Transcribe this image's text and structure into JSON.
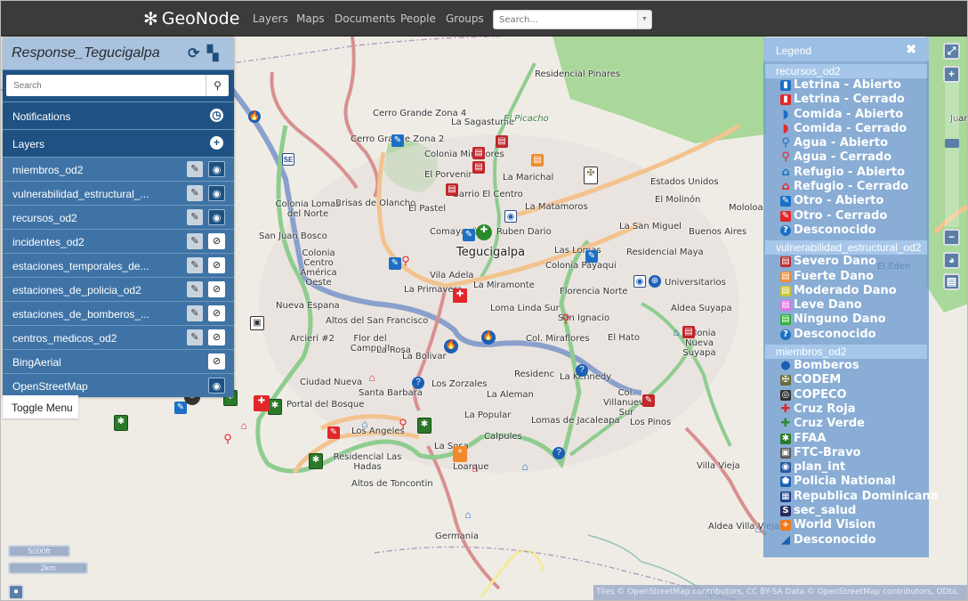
{
  "navbar": {
    "brand": "GeoNode",
    "links": [
      "Layers",
      "Maps",
      "Documents",
      "People",
      "Groups"
    ],
    "search_placeholder": "Search..."
  },
  "panel": {
    "title": "Response_Tegucigalpa",
    "refresh_icon": "refresh-icon",
    "save_icon": "save-icon",
    "search_placeholder": "Search",
    "sections": {
      "notifications": "Notifications",
      "layers": "Layers"
    },
    "layers": [
      {
        "name": "miembros_od2",
        "editable": true,
        "visible": true
      },
      {
        "name": "vulnerabilidad_estructural_...",
        "editable": true,
        "visible": true
      },
      {
        "name": "recursos_od2",
        "editable": true,
        "visible": true
      },
      {
        "name": "incidentes_od2",
        "editable": true,
        "visible": false
      },
      {
        "name": "estaciones_temporales_de...",
        "editable": true,
        "visible": false
      },
      {
        "name": "estaciones_de_policia_od2",
        "editable": true,
        "visible": false
      },
      {
        "name": "estaciones_de_bomberos_...",
        "editable": true,
        "visible": false
      },
      {
        "name": "centros_medicos_od2",
        "editable": true,
        "visible": false
      },
      {
        "name": "BingAerial",
        "editable": false,
        "visible": false
      },
      {
        "name": "OpenStreetMap",
        "editable": false,
        "visible": true
      }
    ],
    "toggle_menu": "Toggle Menu"
  },
  "legend": {
    "title": "Legend",
    "groups": [
      {
        "name": "recursos_od2",
        "items": [
          {
            "label": "Letrina - Abierto",
            "icon": "latrine-icon",
            "color": "#1b6fc4"
          },
          {
            "label": "Letrina - Cerrado",
            "icon": "latrine-icon",
            "color": "#e3262a"
          },
          {
            "label": "Comida - Abierto",
            "icon": "food-icon",
            "color": "#1b6fc4"
          },
          {
            "label": "Comida - Cerrado",
            "icon": "food-icon",
            "color": "#e3262a"
          },
          {
            "label": "Agua - Abierto",
            "icon": "water-tap-icon",
            "color": "#1b6fc4"
          },
          {
            "label": "Agua - Cerrado",
            "icon": "water-tap-icon",
            "color": "#e3262a"
          },
          {
            "label": "Refugio - Abierto",
            "icon": "shelter-icon",
            "color": "#1b6fc4"
          },
          {
            "label": "Refugio - Cerrado",
            "icon": "shelter-icon",
            "color": "#e3262a"
          },
          {
            "label": "Otro - Abierto",
            "icon": "other-icon",
            "color": "#1b6fc4"
          },
          {
            "label": "Otro - Cerrado",
            "icon": "other-icon",
            "color": "#e3262a"
          },
          {
            "label": "Desconocido",
            "icon": "question-icon",
            "color": "#1b6fc4"
          }
        ]
      },
      {
        "name": "vulnerabilidad_estructural_od2",
        "items": [
          {
            "label": "Severo Dano",
            "icon": "building-icon",
            "color": "#c0262a"
          },
          {
            "label": "Fuerte Dano",
            "icon": "building-icon",
            "color": "#f08a2c"
          },
          {
            "label": "Moderado Dano",
            "icon": "building-icon",
            "color": "#c6c62a"
          },
          {
            "label": "Leve Dano",
            "icon": "building-icon",
            "color": "#e36ee3"
          },
          {
            "label": "Ninguno Dano",
            "icon": "building-icon",
            "color": "#2ab52a"
          },
          {
            "label": "Desconocido",
            "icon": "question-icon",
            "color": "#1b6fc4"
          }
        ]
      },
      {
        "name": "miembros_od2",
        "items": [
          {
            "label": "Bomberos",
            "icon": "fire-icon",
            "color": "#1b5fb4"
          },
          {
            "label": "CODEM",
            "icon": "codem-emblem-icon",
            "color": "#6b6b3a"
          },
          {
            "label": "COPECO",
            "icon": "copeco-emblem-icon",
            "color": "#333333"
          },
          {
            "label": "Cruz Roja",
            "icon": "red-cross-icon",
            "color": "#e3262a"
          },
          {
            "label": "Cruz Verde",
            "icon": "green-cross-icon",
            "color": "#2a8a2a"
          },
          {
            "label": "FFAA",
            "icon": "ffaa-star-icon",
            "color": "#2a7a2a"
          },
          {
            "label": "FTC-Bravo",
            "icon": "ftc-bravo-icon",
            "color": "#555555"
          },
          {
            "label": "plan_int",
            "icon": "plan-int-icon",
            "color": "#2a5aa0"
          },
          {
            "label": "Policia National",
            "icon": "police-shield-icon",
            "color": "#1b5fb4"
          },
          {
            "label": "Republica Dominicana",
            "icon": "dominican-flag-icon",
            "color": "#1a3a8a"
          },
          {
            "label": "sec_salud",
            "icon": "sec-salud-icon",
            "color": "#2a2a60"
          },
          {
            "label": "World Vision",
            "icon": "world-vision-icon",
            "color": "#f07a1a"
          },
          {
            "label": "Desconocido",
            "icon": "unknown-icon",
            "color": "#1b5fb4"
          }
        ]
      }
    ]
  },
  "map": {
    "labels": [
      {
        "text": "Residencial Pinares"
      },
      {
        "text": "Cerro Grande Zona 4"
      },
      {
        "text": "La Sagastume"
      },
      {
        "text": "El Picacho"
      },
      {
        "text": "Cerro Grande Zona 2"
      },
      {
        "text": "Colonia Miraflores"
      },
      {
        "text": "El Porvenir"
      },
      {
        "text": "La Marichal"
      },
      {
        "text": "Barrio El Centro"
      },
      {
        "text": "Estados Unidos"
      },
      {
        "text": "El Molinón"
      },
      {
        "text": "Brisas de Olancho"
      },
      {
        "text": "El Pastel"
      },
      {
        "text": "La Matamoros"
      },
      {
        "text": "Mololoa"
      },
      {
        "text": "Colonia Lomas del Norte"
      },
      {
        "text": "San Juan Bosco"
      },
      {
        "text": "Comayagüela"
      },
      {
        "text": "Ruben Dario"
      },
      {
        "text": "La San Miguel"
      },
      {
        "text": "Buenos Aires"
      },
      {
        "text": "Tegucigalpa"
      },
      {
        "text": "Las Lomas"
      },
      {
        "text": "Residencial Maya"
      },
      {
        "text": "Colonia Centro América Oeste"
      },
      {
        "text": "Colonia Payaqui"
      },
      {
        "text": "Vila Adela"
      },
      {
        "text": "La Primavera"
      },
      {
        "text": "La Miramonte"
      },
      {
        "text": "Florencia Norte"
      },
      {
        "text": "Universitarios"
      },
      {
        "text": "Nueva Espana"
      },
      {
        "text": "Loma Linda Sur"
      },
      {
        "text": "Aldea Suyapa"
      },
      {
        "text": "Altos del San Francisco"
      },
      {
        "text": "San Ignacio"
      },
      {
        "text": "Arcieri #2"
      },
      {
        "text": "Flor del Campo II"
      },
      {
        "text": "Col. Miraflores"
      },
      {
        "text": "El Hato"
      },
      {
        "text": "Colonia Nueva Suyapa"
      },
      {
        "text": "La Bolivar"
      },
      {
        "text": "La Rosa"
      },
      {
        "text": "Residenc"
      },
      {
        "text": "Ciudad Nueva"
      },
      {
        "text": "Los Zorzales"
      },
      {
        "text": "La Kennedy"
      },
      {
        "text": "Santa Barbara"
      },
      {
        "text": "La Aleman"
      },
      {
        "text": "Col. Villanueva Sur"
      },
      {
        "text": "Portal del Bosque"
      },
      {
        "text": "La Popular"
      },
      {
        "text": "Lomas de Jacaleapa"
      },
      {
        "text": "Los Pinos"
      },
      {
        "text": "Los Angeles"
      },
      {
        "text": "Calpules"
      },
      {
        "text": "La Sosa"
      },
      {
        "text": "Residencial Las Hadas"
      },
      {
        "text": "Loarque"
      },
      {
        "text": "Villa Vieja"
      },
      {
        "text": "Altos de Toncontin"
      },
      {
        "text": "Germania"
      },
      {
        "text": "Aldea Villa Vieja"
      },
      {
        "text": "El Eden"
      },
      {
        "text": "Juan"
      }
    ],
    "scale": {
      "imperial": "5000ft",
      "metric": "2km"
    },
    "attribution": "Tiles © OpenStreetMap contributors, CC BY-SA  Data © OpenStreetMap contributors, ODbL"
  },
  "controls": {
    "fullscreen": "fullscreen-icon",
    "zoom_in": "+",
    "zoom_out": "−",
    "zoom_level_fraction": 0.35
  }
}
